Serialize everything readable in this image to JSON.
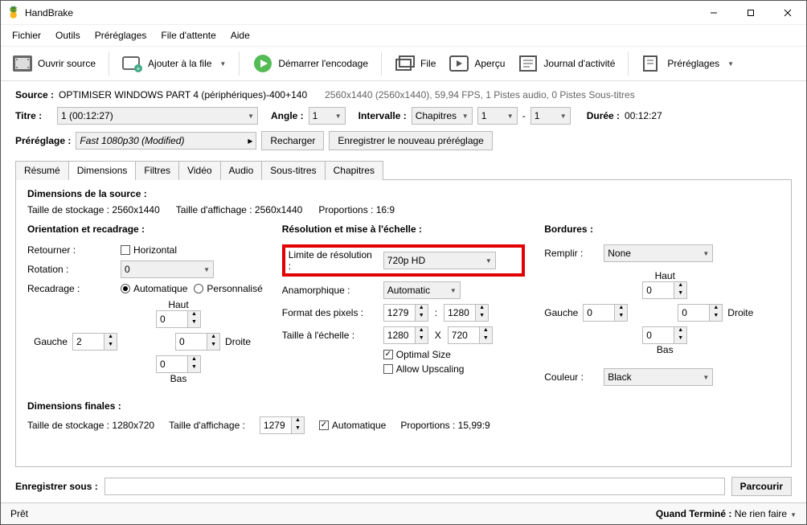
{
  "app": {
    "title": "HandBrake"
  },
  "menu": {
    "file": "Fichier",
    "tools": "Outils",
    "presets": "Préréglages",
    "queue": "File d'attente",
    "help": "Aide"
  },
  "toolbar": {
    "open_source": "Ouvrir source",
    "add_to_queue": "Ajouter à la file",
    "start_encode": "Démarrer l'encodage",
    "file": "File",
    "preview": "Aperçu",
    "activity": "Journal d'activité",
    "presets": "Préréglages"
  },
  "source": {
    "label": "Source :",
    "name": "OPTIMISER WINDOWS PART 4 (périphériques)-400+140",
    "info": "2560x1440 (2560x1440), 59,94 FPS, 1 Pistes audio, 0 Pistes Sous-titres"
  },
  "title_row": {
    "label": "Titre :",
    "value": "1  (00:12:27)",
    "angle_label": "Angle :",
    "angle": "1",
    "range_label": "Intervalle :",
    "range_type": "Chapitres",
    "range_from": "1",
    "dash": "-",
    "range_to": "1",
    "duration_label": "Durée :",
    "duration": "00:12:27"
  },
  "preset_row": {
    "label": "Préréglage :",
    "preset_name": "Fast 1080p30  (Modified)",
    "reload": "Recharger",
    "save": "Enregistrer le nouveau préréglage"
  },
  "tabs": {
    "summary": "Résumé",
    "dimensions": "Dimensions",
    "filters": "Filtres",
    "video": "Vidéo",
    "audio": "Audio",
    "subs": "Sous-titres",
    "chapters": "Chapitres"
  },
  "src_dims": {
    "heading": "Dimensions de la source :",
    "storage": "Taille de stockage : 2560x1440",
    "display": "Taille d'affichage : 2560x1440",
    "par": "Proportions : 16:9"
  },
  "orient": {
    "heading": "Orientation et recadrage :",
    "flip_label": "Retourner :",
    "flip_check": "Horizontal",
    "rotation_label": "Rotation :",
    "rotation": "0",
    "cropping_label": "Recadrage :",
    "auto": "Automatique",
    "custom": "Personnalisé",
    "top_lbl": "Haut",
    "bottom_lbl": "Bas",
    "left_lbl": "Gauche",
    "right_lbl": "Droite",
    "top": "0",
    "bottom": "0",
    "left": "2",
    "right": "0"
  },
  "res": {
    "heading": "Résolution et mise à l'échelle :",
    "limit_label": "Limite de résolution :",
    "limit": "720p HD",
    "anamorphic_label": "Anamorphique :",
    "anamorphic": "Automatic",
    "pixel_aspect_label": "Format des pixels :",
    "pa_w": "1279",
    "pa_h": "1280",
    "scaled_label": "Taille à l'échelle :",
    "scaled_w": "1280",
    "scaled_h": "720",
    "optimal": "Optimal Size",
    "upscale": "Allow Upscaling"
  },
  "borders": {
    "heading": "Bordures :",
    "fill_label": "Remplir :",
    "fill": "None",
    "top_lbl": "Haut",
    "bottom_lbl": "Bas",
    "left_lbl": "Gauche",
    "right_lbl": "Droite",
    "top": "0",
    "bottom": "0",
    "left": "0",
    "right": "0",
    "color_label": "Couleur :",
    "color": "Black"
  },
  "final": {
    "heading": "Dimensions finales :",
    "storage": "Taille de stockage : 1280x720",
    "display_label": "Taille d'affichage :",
    "display_val": "1279",
    "auto": "Automatique",
    "par": "Proportions : 15,99:9"
  },
  "save_as": {
    "label": "Enregistrer sous :",
    "value": "",
    "browse": "Parcourir"
  },
  "status": {
    "left": "Prêt",
    "done_label": "Quand Terminé :",
    "done_value": "Ne rien faire"
  }
}
